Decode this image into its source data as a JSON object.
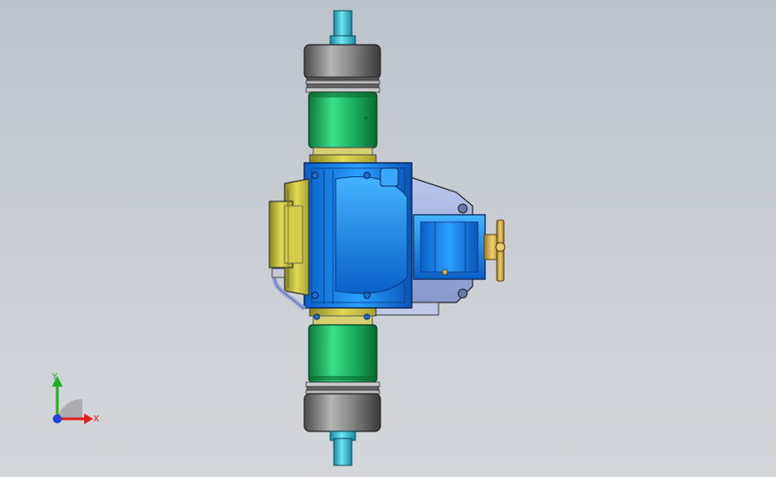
{
  "viewport": {
    "background_top": "#bcc3cc",
    "background_bottom": "#d4d6da"
  },
  "model": {
    "colors": {
      "housing_blue": "#1e8cf0",
      "housing_blue_dark": "#0a55b8",
      "cover_yellow": "#c9c43a",
      "tire_green": "#22c06a",
      "drum_gray": "#7f7f7f",
      "shaft_cyan": "#39c6d8",
      "flange_gold": "#d9b24a",
      "bracket_lilac": "#a6b4e0"
    }
  },
  "triad": {
    "x_label": "X",
    "y_label": "Y",
    "x_color": "#e02020",
    "y_color": "#20b020",
    "z_color": "#2040e0"
  }
}
